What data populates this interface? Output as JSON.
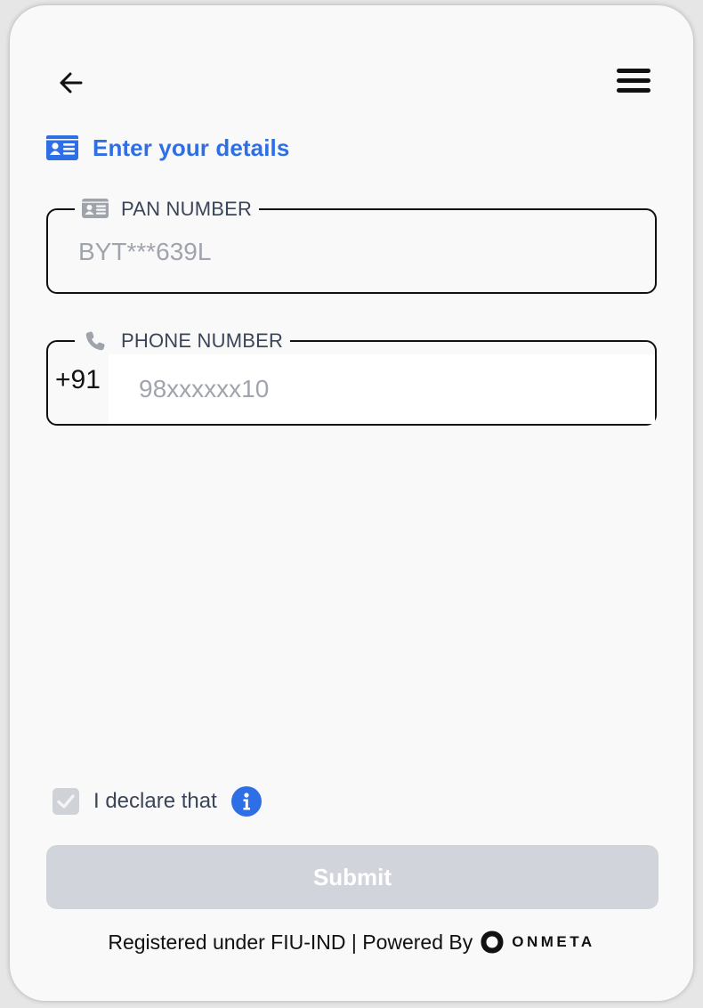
{
  "header": {
    "back_icon": "arrow-left-icon",
    "menu_icon": "hamburger-menu-icon"
  },
  "heading": {
    "icon": "id-card-icon",
    "title": "Enter your details",
    "color": "#2f6fe5"
  },
  "form": {
    "pan": {
      "icon": "id-card-icon",
      "label": "PAN NUMBER",
      "placeholder": "BYT***639L",
      "value": ""
    },
    "phone": {
      "icon": "phone-icon",
      "label": "PHONE NUMBER",
      "country_code": "+91",
      "placeholder": "98xxxxxx10",
      "value": ""
    }
  },
  "declaration": {
    "checked": true,
    "text": "I declare that",
    "info_icon": "info-icon",
    "info_color": "#2f6fe5"
  },
  "submit": {
    "label": "Submit",
    "disabled": true,
    "bg_color": "#d1d5db"
  },
  "footer": {
    "text": "Registered under FIU-IND | Powered By",
    "brand_icon": "onmeta-logo-icon",
    "brand": "ONMETA"
  }
}
